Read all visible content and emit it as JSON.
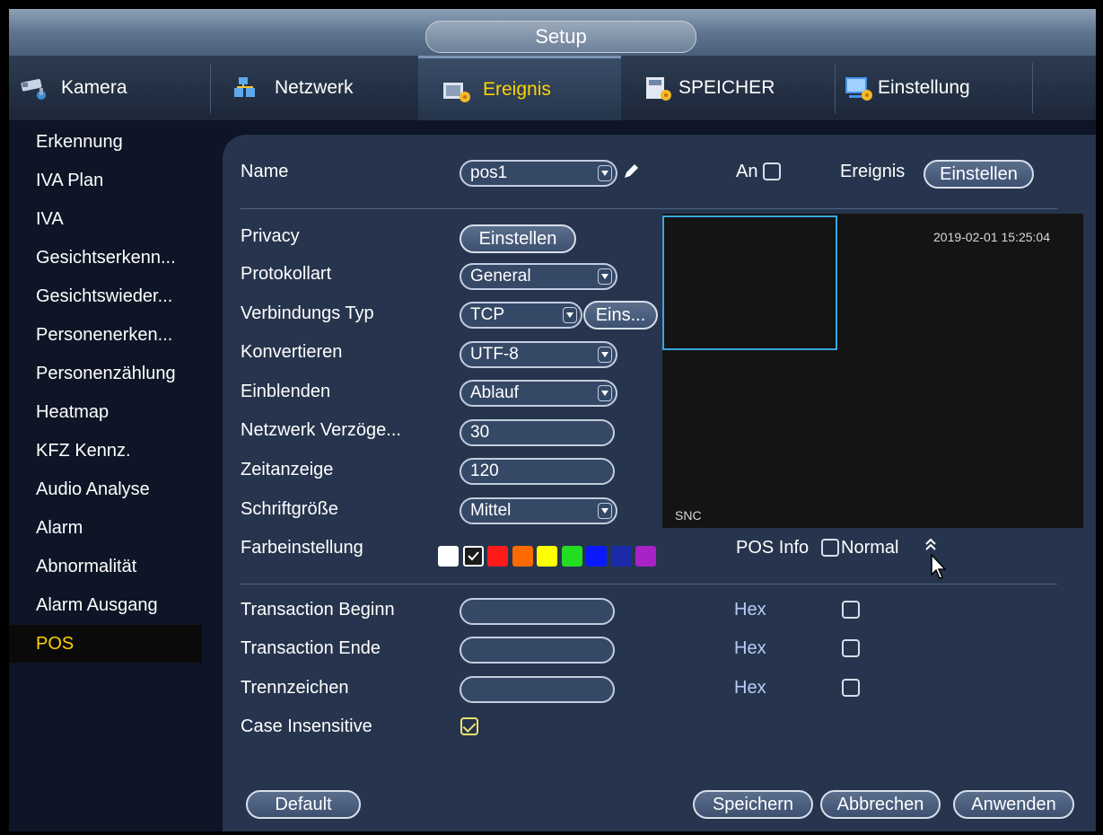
{
  "window": {
    "title": "Setup"
  },
  "tabs": [
    {
      "label": "Kamera",
      "icon": "camera-icon"
    },
    {
      "label": "Netzwerk",
      "icon": "network-icon"
    },
    {
      "label": "Ereignis",
      "icon": "event-icon",
      "active": true
    },
    {
      "label": "SPEICHER",
      "icon": "storage-icon"
    },
    {
      "label": "Einstellung",
      "icon": "settings-icon"
    }
  ],
  "sidebar": {
    "items": [
      "Erkennung",
      "IVA Plan",
      "IVA",
      "Gesichtserkenn...",
      "Gesichtswieder...",
      "Personenerken...",
      "Personenzählung",
      "Heatmap",
      "KFZ Kennz.",
      "Audio Analyse",
      "Alarm",
      "Abnormalität",
      "Alarm Ausgang",
      "POS"
    ],
    "active": "POS"
  },
  "form": {
    "name": {
      "label": "Name",
      "value": "pos1"
    },
    "an_label": "An",
    "ereignis_label": "Ereignis",
    "ereignis_button": "Einstellen",
    "privacy": {
      "label": "Privacy",
      "button": "Einstellen"
    },
    "protokollart": {
      "label": "Protokollart",
      "value": "General"
    },
    "verbindungs_typ": {
      "label": "Verbindungs Typ",
      "value": "TCP",
      "button": "Eins..."
    },
    "konvertieren": {
      "label": "Konvertieren",
      "value": "UTF-8"
    },
    "einblenden": {
      "label": "Einblenden",
      "value": "Ablauf"
    },
    "netzwerk_verzoegerung": {
      "label": "Netzwerk Verzöge...",
      "value": "30"
    },
    "zeitanzeige": {
      "label": "Zeitanzeige",
      "value": "120"
    },
    "schriftgroesse": {
      "label": "Schriftgröße",
      "value": "Mittel"
    },
    "farbeinstellung": {
      "label": "Farbeinstellung",
      "colors": [
        "#ffffff",
        "#1b1b1b",
        "#ff1a1a",
        "#ff6a00",
        "#ffff00",
        "#22dd22",
        "#0a1aff",
        "#1a2aa8",
        "#a822c8"
      ],
      "selected_index": 1
    },
    "pos_info_label": "POS Info",
    "normal_label": "Normal",
    "transaction_beginn": {
      "label": "Transaction Beginn",
      "value": "",
      "hex_label": "Hex"
    },
    "transaction_ende": {
      "label": "Transaction Ende",
      "value": "",
      "hex_label": "Hex"
    },
    "trennzeichen": {
      "label": "Trennzeichen",
      "value": "",
      "hex_label": "Hex"
    },
    "case_insensitive": {
      "label": "Case Insensitive",
      "checked": true
    }
  },
  "preview": {
    "timestamp": "2019-02-01 15:25:04",
    "camera_label": "SNC"
  },
  "footer": {
    "default": "Default",
    "save": "Speichern",
    "cancel": "Abbrechen",
    "apply": "Anwenden"
  }
}
